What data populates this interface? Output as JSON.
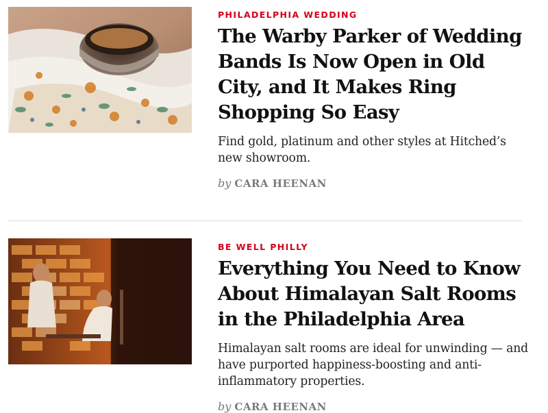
{
  "articles": [
    {
      "category": "PHILADELPHIA WEDDING",
      "headline": "The Warby Parker of Wedding Bands Is Now Open in Old City, and It Makes Ring Shopping So Easy",
      "dek": "Find gold, platinum and other styles at Hitched’s new showroom.",
      "byline_prefix": "by",
      "author": "CARA HEENAN"
    },
    {
      "category": "BE WELL PHILLY",
      "headline": "Everything You Need to Know About Himalayan Salt Rooms in the Philadelphia Area",
      "dek": "Himalayan salt rooms are ideal for unwinding — and have purported happiness-boosting and anti-inflammatory properties.",
      "byline_prefix": "by",
      "author": "CARA HEENAN"
    }
  ],
  "colors": {
    "category": "#d4001a",
    "headline": "#111111",
    "byline": "#777777",
    "divider": "#dcdcdc"
  }
}
